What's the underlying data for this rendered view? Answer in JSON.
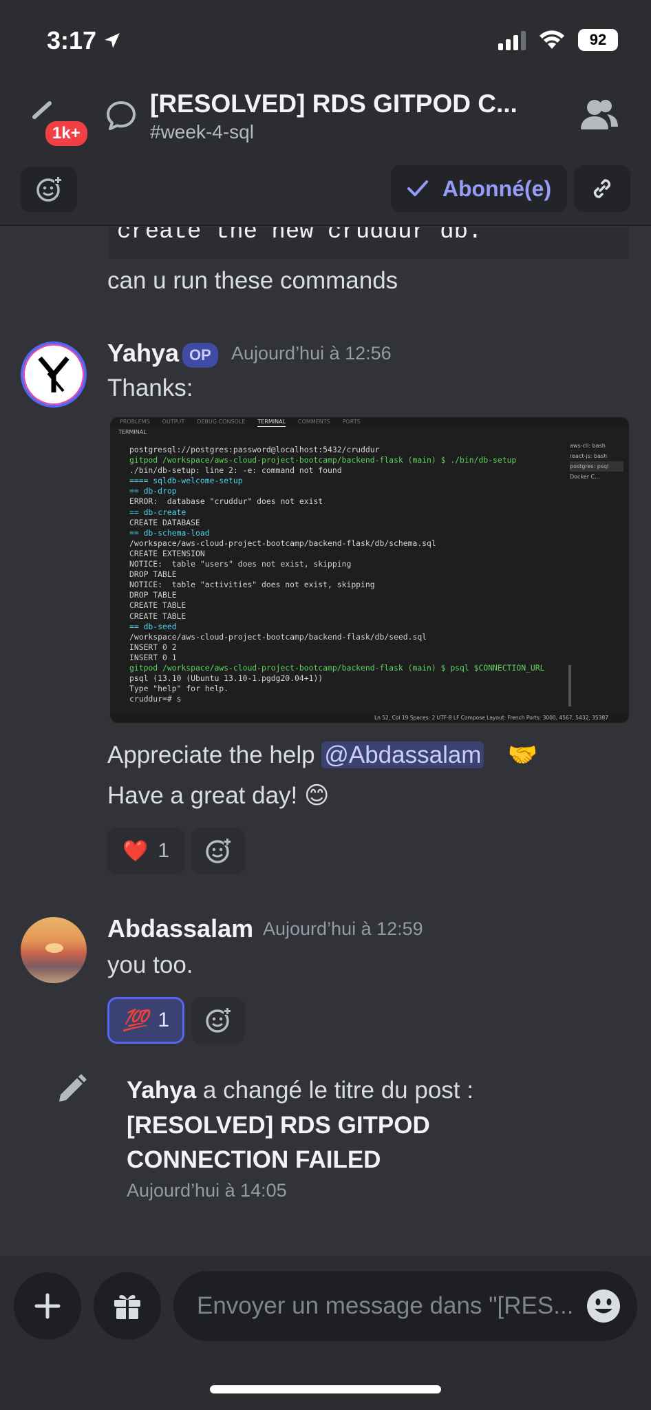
{
  "status": {
    "time": "3:17",
    "battery": "92"
  },
  "header": {
    "unread_badge": "1k+",
    "title": "[RESOLVED] RDS GITPOD C...",
    "channel": "#week-4-sql"
  },
  "actions": {
    "follow_label": "Abonné(e)"
  },
  "messages": {
    "prev_code": "create the new cruddur db.",
    "prev_text": "can u run these commands",
    "yahya": {
      "author": "Yahya",
      "op_badge": "OP",
      "timestamp": "Aujourd’hui à 12:56",
      "line1": "Thanks:",
      "line2_prefix": "Appreciate the help ",
      "mention": "@Abdassalam",
      "line2_suffix": "🤝",
      "line3": "Have a great day! 😊",
      "reaction_emoji": "❤️",
      "reaction_count": "1"
    },
    "abd": {
      "author": "Abdassalam",
      "timestamp": "Aujourd’hui à 12:59",
      "text": "you too.",
      "reaction_emoji": "💯",
      "reaction_count": "1"
    },
    "system": {
      "actor": "Yahya",
      "action": " a changé le titre du post :",
      "new_title": "[RESOLVED] RDS GITPOD CONNECTION FAILED",
      "timestamp": "Aujourd’hui à 14:05"
    }
  },
  "screenshot": {
    "tabs": [
      "PROBLEMS",
      "OUTPUT",
      "DEBUG CONSOLE",
      "TERMINAL",
      "COMMENTS",
      "PORTS"
    ],
    "panel_label": "TERMINAL",
    "lines": [
      "postgresql://postgres:password@localhost:5432/cruddur",
      "gitpod /workspace/aws-cloud-project-bootcamp/backend-flask (main) $ ./bin/db-setup",
      "./bin/db-setup: line 2: -e: command not found",
      "==== sqldb-welcome-setup",
      "== db-drop",
      "ERROR:  database \"cruddur\" does not exist",
      "== db-create",
      "CREATE DATABASE",
      "== db-schema-load",
      "/workspace/aws-cloud-project-bootcamp/backend-flask/db/schema.sql",
      "CREATE EXTENSION",
      "NOTICE:  table \"users\" does not exist, skipping",
      "DROP TABLE",
      "NOTICE:  table \"activities\" does not exist, skipping",
      "DROP TABLE",
      "CREATE TABLE",
      "CREATE TABLE",
      "== db-seed",
      "/workspace/aws-cloud-project-bootcamp/backend-flask/db/seed.sql",
      "INSERT 0 2",
      "INSERT 0 1",
      "gitpod /workspace/aws-cloud-project-bootcamp/backend-flask (main) $ psql $CONNECTION_URL",
      "psql (13.10 (Ubuntu 13.10-1.pgdg20.04+1))",
      "Type \"help\" for help.",
      "",
      "cruddur=# s"
    ],
    "side": [
      "aws-cli: bash",
      "react-js: bash",
      "postgres: psql",
      "Docker C..."
    ],
    "statusbar": "Ln 52, Col 19   Spaces: 2   UTF-8   LF   Compose   Layout: French   Ports: 3000, 4567, 5432, 35387"
  },
  "composer": {
    "placeholder": "Envoyer un message dans \"[RES..."
  }
}
